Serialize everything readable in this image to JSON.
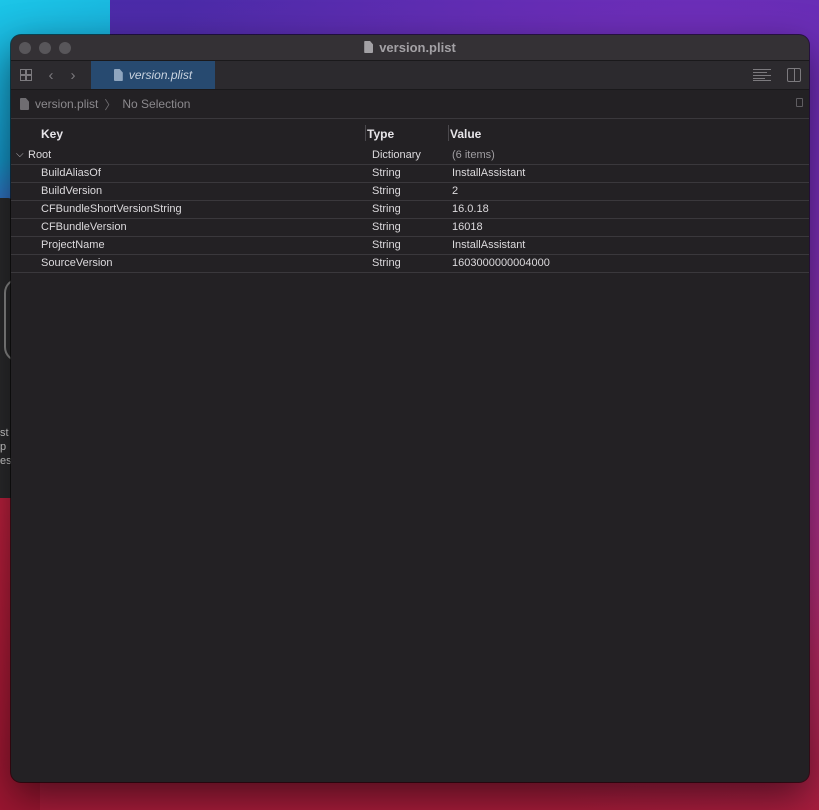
{
  "window": {
    "title": "version.plist"
  },
  "toolbar": {
    "tab_label": "version.plist"
  },
  "jumpbar": {
    "file": "version.plist",
    "selection": "No Selection"
  },
  "table": {
    "headers": {
      "key": "Key",
      "type": "Type",
      "value": "Value"
    },
    "root": {
      "key": "Root",
      "type": "Dictionary",
      "value": "(6 items)"
    },
    "rows": [
      {
        "key": "BuildAliasOf",
        "type": "String",
        "value": "InstallAssistant"
      },
      {
        "key": "BuildVersion",
        "type": "String",
        "value": "2"
      },
      {
        "key": "CFBundleShortVersionString",
        "type": "String",
        "value": "16.0.18"
      },
      {
        "key": "CFBundleVersion",
        "type": "String",
        "value": "16018"
      },
      {
        "key": "ProjectName",
        "type": "String",
        "value": "InstallAssistant"
      },
      {
        "key": "SourceVersion",
        "type": "String",
        "value": "1603000000004000"
      }
    ]
  },
  "background_window": {
    "fragments": [
      "st",
      "p",
      "es"
    ]
  },
  "icons": {
    "document": "document-icon",
    "grid": "grid-icon",
    "back": "chevron-left-icon",
    "forward": "chevron-right-icon",
    "minimap": "lines-icon",
    "inspector": "sidebar-toggle-icon",
    "disclosure": "chevron-down-icon"
  },
  "colors": {
    "tab_active": "#274a70",
    "window_bg": "#232124"
  }
}
